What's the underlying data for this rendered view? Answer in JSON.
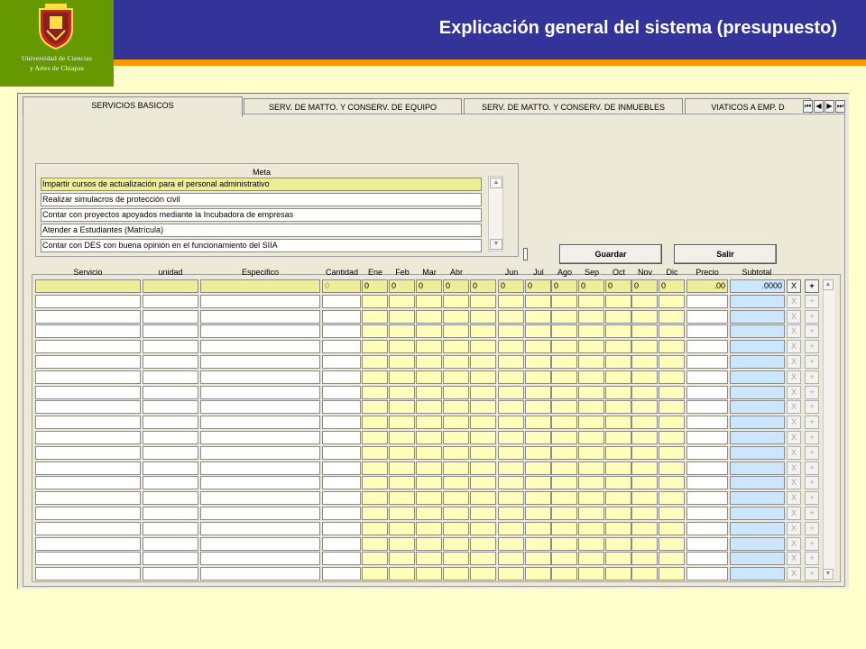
{
  "slide": {
    "title": "Explicación general del sistema (presupuesto)",
    "logo_line1": "Universidad de Ciencias",
    "logo_line2": "y Artes de Chiapas",
    "colors": {
      "logo_bg": "#669900",
      "title_bar": "#333399",
      "accent_bar": "#ff9900",
      "background": "#ffffcc"
    }
  },
  "tabs": [
    {
      "label": "SERVICIOS BASICOS",
      "active": true
    },
    {
      "label": "SERV. DE MATTO. Y CONSERV. DE EQUIPO",
      "active": false
    },
    {
      "label": "SERV. DE MATTO. Y CONSERV. DE INMUEBLES",
      "active": false
    },
    {
      "label": "VIATICOS A EMP. D",
      "active": false
    }
  ],
  "tab_nav": [
    "⏮",
    "◀",
    "▶",
    "⏭"
  ],
  "meta": {
    "title": "Meta",
    "rows": [
      "Impartir  cursos de actualización para el personal administrativo",
      "Realizar simulacros de protección civil",
      "Contar  con proyectos apoyados mediante la Incubadora de empresas",
      "Atender a Estudiantes (Matrícula)",
      "Contar con DES con buena opinión en el funcionamiento del  SIIA"
    ],
    "selected_index": 0
  },
  "buttons": {
    "guardar": "Guardar",
    "salir": "Salir"
  },
  "table": {
    "headers": {
      "servicio": "Servicio",
      "unidad": "unidad",
      "especifico": "Especifico",
      "cantidad": "Cantidad",
      "ene": "Ene",
      "feb": "Feb",
      "mar": "Mar",
      "abr": "Abr",
      "jun": "Jun",
      "jul": "Jul",
      "ago": "Ago",
      "sep": "Sep",
      "oct": "Oct",
      "nov": "Nov",
      "dic": "Dic",
      "precio": "Precio",
      "subtotal": "Subtotal"
    },
    "first_row": {
      "cantidad": "0",
      "months": [
        "0",
        "0",
        "0",
        "0",
        "0",
        "0",
        "0",
        "0",
        "0",
        "0",
        "0",
        "0"
      ],
      "precio": ".00",
      "subtotal": ".0000"
    },
    "row_count": 20,
    "delete_label": "X",
    "add_label": "+"
  }
}
